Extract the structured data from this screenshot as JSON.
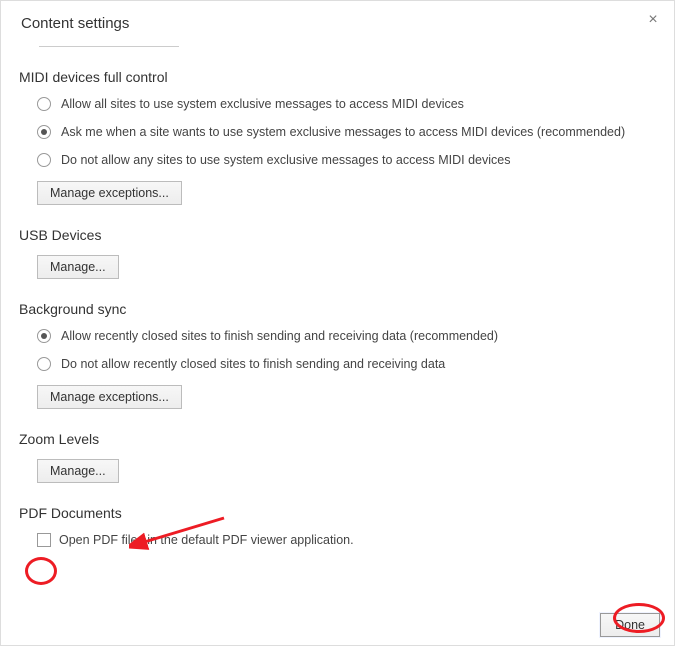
{
  "header": {
    "title": "Content settings"
  },
  "midi": {
    "title": "MIDI devices full control",
    "opt1": "Allow all sites to use system exclusive messages to access MIDI devices",
    "opt2": "Ask me when a site wants to use system exclusive messages to access MIDI devices (recommended)",
    "opt3": "Do not allow any sites to use system exclusive messages to access MIDI devices",
    "manage": "Manage exceptions..."
  },
  "usb": {
    "title": "USB Devices",
    "manage": "Manage..."
  },
  "bgsync": {
    "title": "Background sync",
    "opt1": "Allow recently closed sites to finish sending and receiving data (recommended)",
    "opt2": "Do not allow recently closed sites to finish sending and receiving data",
    "manage": "Manage exceptions..."
  },
  "zoom": {
    "title": "Zoom Levels",
    "manage": "Manage..."
  },
  "pdf": {
    "title": "PDF Documents",
    "opt1": "Open PDF files in the default PDF viewer application."
  },
  "footer": {
    "done": "Done"
  }
}
